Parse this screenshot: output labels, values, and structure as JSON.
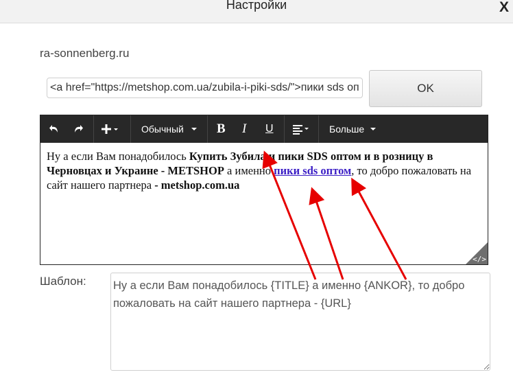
{
  "dialog": {
    "title": "Настройки",
    "close_label": "X"
  },
  "site": {
    "domain": "ra-sonnenberg.ru"
  },
  "link_input": {
    "value": "<a href=\"https://metshop.com.ua/zubila-i-piki-sds/\">пики sds оптом</a>"
  },
  "ok_button": {
    "label": "OK"
  },
  "toolbar": {
    "undo_icon": "undo-icon",
    "redo_icon": "redo-icon",
    "insert_icon": "plus-icon",
    "paragraph_format": "Обычный",
    "bold": "B",
    "italic": "I",
    "underline": "U",
    "align_icon": "align-left-icon",
    "more": "Больше"
  },
  "editor": {
    "p1": "Ну а если Вам понадобилось ",
    "title_bold": "Купить Зубила и пики SDS оптом и в розницу в Черновцах и Украине - METSHOP",
    "p2": " а именно ",
    "anchor": "пики sds оптом",
    "p3": ", то добро пожаловать на сайт нашего партнера ",
    "url_bold": "- metshop.com.ua",
    "code_view_icon": "code-icon"
  },
  "template": {
    "label": "Шаблон:",
    "value": "Ну а если Вам понадобилось {TITLE} а именно {ANKOR}, то добро пожаловать на сайт нашего партнера - {URL}"
  },
  "colors": {
    "toolbar_bg": "#282828",
    "link": "#3b1ec5",
    "arrow": "#e60000"
  }
}
